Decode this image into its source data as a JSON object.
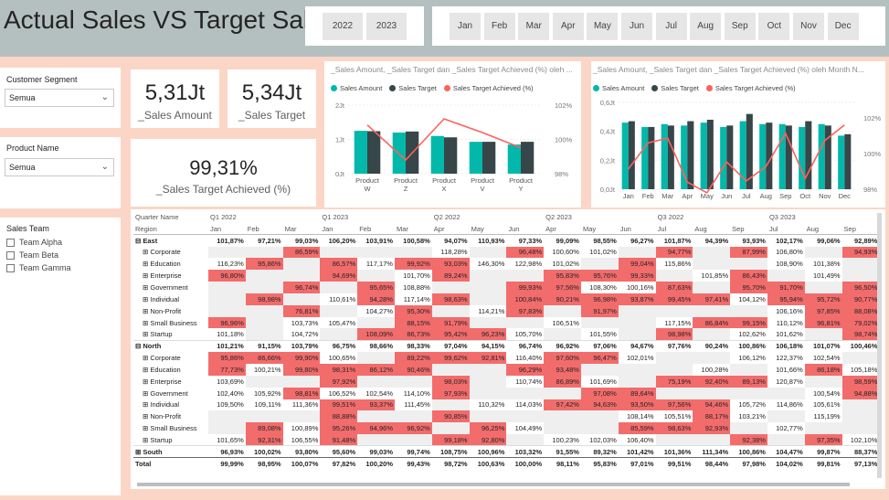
{
  "app": {
    "title": "Actual Sales VS Target Sales"
  },
  "years": [
    "2022",
    "2023"
  ],
  "months": [
    "Jan",
    "Feb",
    "Mar",
    "Apr",
    "May",
    "Jun",
    "Jul",
    "Aug",
    "Sep",
    "Oct",
    "Nov",
    "Dec"
  ],
  "slicers": {
    "segment": {
      "title": "Customer Segment",
      "value": "Semua"
    },
    "product": {
      "title": "Product Name",
      "value": "Semua"
    },
    "team": {
      "title": "Sales Team",
      "items": [
        "Team Alpha",
        "Team Beta",
        "Team Gamma"
      ]
    }
  },
  "kpis": {
    "amount": {
      "value": "5,31Jt",
      "label": "_Sales Amount"
    },
    "target": {
      "value": "5,34Jt",
      "label": "_Sales Target"
    },
    "achieved": {
      "value": "99,31%",
      "label": "_Sales Target Achieved (%)"
    }
  },
  "chart1": {
    "title": "_Sales Amount, _Sales Target dan _Sales Target Achieved (%) oleh ..."
  },
  "chart2": {
    "title": "_Sales Amount, _Sales Target dan _Sales Target Achieved (%) oleh Month N..."
  },
  "legend": [
    "Sales Amount",
    "Sales Target",
    "Sales Target Achieved (%)"
  ],
  "colors": {
    "amount": "#01b8aa",
    "target": "#374649",
    "achieved": "#fd625e",
    "highlight": "#f26c6c"
  },
  "chart_data": [
    {
      "type": "bar",
      "title": "_Sales Amount, _Sales Target dan _Sales Target Achieved (%) oleh ...",
      "categories": [
        "Product W",
        "Product Z",
        "Product X",
        "Product V",
        "Product Y"
      ],
      "series": [
        {
          "name": "Sales Amount",
          "axis": "left",
          "values": [
            1.25,
            1.2,
            1.1,
            0.93,
            0.85
          ]
        },
        {
          "name": "Sales Target",
          "axis": "left",
          "values": [
            1.24,
            1.23,
            1.06,
            0.93,
            0.93
          ]
        },
        {
          "name": "Sales Target Achieved (%)",
          "axis": "right",
          "values": [
            100.7,
            98.4,
            101.1,
            100.2,
            99.2
          ]
        }
      ],
      "yticks_left": [
        "0Jt",
        "1Jt",
        "2Jt"
      ],
      "ylim_left": [
        0,
        2
      ],
      "yticks_right": [
        "98%",
        "100%",
        "102%"
      ],
      "ylim_right": [
        97.5,
        102
      ]
    },
    {
      "type": "bar",
      "title": "_Sales Amount, _Sales Target dan _Sales Target Achieved (%) oleh Month N...",
      "categories": [
        "Jan",
        "Feb",
        "Mar",
        "Apr",
        "May",
        "Jun",
        "Jul",
        "Aug",
        "Sep",
        "Oct",
        "Nov",
        "Dec"
      ],
      "series": [
        {
          "name": "Sales Amount",
          "axis": "left",
          "values": [
            0.46,
            0.43,
            0.45,
            0.44,
            0.46,
            0.43,
            0.47,
            0.45,
            0.45,
            0.43,
            0.45,
            0.37
          ]
        },
        {
          "name": "Sales Target",
          "axis": "left",
          "values": [
            0.47,
            0.43,
            0.44,
            0.47,
            0.48,
            0.44,
            0.52,
            0.46,
            0.44,
            0.47,
            0.44,
            0.38
          ]
        },
        {
          "name": "Sales Target Achieved (%)",
          "axis": "right",
          "values": [
            98.7,
            100.9,
            101.3,
            97.6,
            96.7,
            99.3,
            97.7,
            98.9,
            101.7,
            97.9,
            101.1,
            102.4
          ]
        }
      ],
      "yticks_left": [
        "0,0Jt",
        "0,2Jt",
        "0,4Jt",
        "0,6Jt"
      ],
      "ylim_left": [
        0,
        0.6
      ],
      "yticks_right": [
        "98%",
        "100%",
        "102%"
      ],
      "ylim_right": [
        97,
        103
      ]
    }
  ],
  "matrix": {
    "header_quarter": [
      "Quarter Name",
      "Q1 2022",
      "",
      "",
      "Q1 2023",
      "",
      "",
      "Q2 2022",
      "",
      "",
      "Q2 2023",
      "",
      "",
      "Q3 2022",
      "",
      "",
      "Q3 2023",
      "",
      ""
    ],
    "header_region": [
      "Region",
      "Jan",
      "Feb",
      "Mar",
      "Jan",
      "Feb",
      "Mar",
      "Apr",
      "May",
      "Jun",
      "Apr",
      "May",
      "Jun",
      "Jul",
      "Aug",
      "Sep",
      "Jul",
      "Aug",
      "Sep"
    ],
    "rows": [
      {
        "k": "reg",
        "label": "⊟ East",
        "v": [
          "101,87%",
          "97,21%",
          "99,03%",
          "106,20%",
          "103,91%",
          "100,58%",
          "94,07%",
          "110,93%",
          "97,33%",
          "99,09%",
          "98,55%",
          "96,27%",
          "101,87%",
          "94,39%",
          "93,93%",
          "102,17%",
          "99,06%",
          "92,89%"
        ]
      },
      {
        "k": "sub",
        "label": "⊞ Corporate",
        "v": [
          "",
          "",
          "86,59%",
          "",
          "",
          "",
          "118,28%",
          "",
          "96,48%",
          "100,60%",
          "101,02%",
          "",
          "94,77%",
          "",
          "87,99%",
          "106,80%",
          "",
          "94,93%"
        ]
      },
      {
        "k": "sub",
        "label": "⊞ Education",
        "v": [
          "116,23%",
          "95,86%",
          "",
          "86,57%",
          "117,17%",
          "99,92%",
          "93,03%",
          "146,30%",
          "122,98%",
          "101,02%",
          "",
          "99,04%",
          "115,86%",
          "",
          "",
          "108,90%",
          "101,38%",
          ""
        ]
      },
      {
        "k": "sub",
        "label": "⊞ Enterprise",
        "v": [
          "96,80%",
          "",
          "",
          "94,69%",
          "",
          "101,70%",
          "89,24%",
          "",
          "",
          "95,83%",
          "95,76%",
          "99,33%",
          "",
          "101,85%",
          "86,43%",
          "",
          "101,49%",
          ""
        ]
      },
      {
        "k": "sub",
        "label": "⊞ Government",
        "v": [
          "",
          "",
          "96,74%",
          "",
          "95,65%",
          "108,88%",
          "",
          "",
          "99,93%",
          "97,56%",
          "108,30%",
          "100,16%",
          "87,63%",
          "",
          "95,70%",
          "91,70%",
          "",
          "96,50%"
        ]
      },
      {
        "k": "sub",
        "label": "⊞ Individual",
        "v": [
          "",
          "98,98%",
          "",
          "110,61%",
          "94,28%",
          "117,14%",
          "98,63%",
          "",
          "100,84%",
          "90,21%",
          "96,98%",
          "93,87%",
          "99,45%",
          "97,41%",
          "104,12%",
          "95,94%",
          "95,72%",
          "90,77%"
        ]
      },
      {
        "k": "sub",
        "label": "⊞ Non-Profit",
        "v": [
          "",
          "",
          "76,81%",
          "",
          "104,27%",
          "95,30%",
          "",
          "114,21%",
          "97,83%",
          "",
          "91,97%",
          "",
          "",
          "",
          "",
          "106,16%",
          "97,85%",
          "88,08%"
        ]
      },
      {
        "k": "sub",
        "label": "⊞ Small Business",
        "v": [
          "96,96%",
          "",
          "103,73%",
          "105,47%",
          "",
          "88,15%",
          "91,79%",
          "",
          "",
          "106,51%",
          "",
          "",
          "117,15%",
          "86,84%",
          "99,15%",
          "110,12%",
          "96,81%",
          "79,02%"
        ]
      },
      {
        "k": "sub",
        "label": "⊞ Startup",
        "v": [
          "101,18%",
          "",
          "104,72%",
          "",
          "108,09%",
          "86,73%",
          "95,42%",
          "96,23%",
          "105,70%",
          "",
          "101,55%",
          "",
          "98,98%",
          "",
          "102,62%",
          "101,62%",
          "",
          "98,74%"
        ]
      },
      {
        "k": "reg",
        "label": "⊟ North",
        "v": [
          "101,21%",
          "91,15%",
          "103,79%",
          "96,75%",
          "98,66%",
          "98,33%",
          "97,04%",
          "94,15%",
          "96,74%",
          "96,92%",
          "97,06%",
          "94,67%",
          "97,76%",
          "90,24%",
          "100,86%",
          "106,18%",
          "101,07%",
          "100,46%"
        ]
      },
      {
        "k": "sub",
        "label": "⊞ Corporate",
        "v": [
          "95,86%",
          "86,66%",
          "99,90%",
          "100,65%",
          "",
          "89,22%",
          "99,62%",
          "92,81%",
          "116,40%",
          "97,60%",
          "96,47%",
          "102,01%",
          "",
          "",
          "106,12%",
          "122,37%",
          "102,54%",
          ""
        ]
      },
      {
        "k": "sub",
        "label": "⊞ Education",
        "v": [
          "77,73%",
          "100,21%",
          "99,80%",
          "98,31%",
          "86,12%",
          "90,46%",
          "",
          "",
          "96,29%",
          "93,48%",
          "",
          "",
          "",
          "100,28%",
          "",
          "101,66%",
          "86,18%",
          "105,18%"
        ]
      },
      {
        "k": "sub",
        "label": "⊞ Enterprise",
        "v": [
          "103,69%",
          "",
          "",
          "97,92%",
          "",
          "",
          "98,03%",
          "",
          "110,74%",
          "86,89%",
          "101,69%",
          "",
          "75,19%",
          "92,40%",
          "89,13%",
          "120,87%",
          "",
          "98,59%"
        ]
      },
      {
        "k": "sub",
        "label": "⊞ Government",
        "v": [
          "102,40%",
          "105,92%",
          "98,81%",
          "106,52%",
          "102,54%",
          "114,10%",
          "97,93%",
          "",
          "",
          "",
          "97,08%",
          "89,64%",
          "",
          "",
          "",
          "",
          "100,54%",
          "94,88%"
        ]
      },
      {
        "k": "sub",
        "label": "⊞ Individual",
        "v": [
          "109,50%",
          "109,11%",
          "111,36%",
          "99,51%",
          "93,37%",
          "111,45%",
          "",
          "110,32%",
          "114,03%",
          "97,42%",
          "94,63%",
          "93,50%",
          "97,56%",
          "94,46%",
          "105,72%",
          "114,86%",
          "105,61%",
          ""
        ]
      },
      {
        "k": "sub",
        "label": "⊞ Non-Profit",
        "v": [
          "",
          "",
          "",
          "88,88%",
          "",
          "",
          "90,85%",
          "",
          "",
          "",
          "",
          "108,14%",
          "105,51%",
          "88,17%",
          "103,21%",
          "",
          "115,19%",
          ""
        ]
      },
      {
        "k": "sub",
        "label": "⊞ Small Business",
        "v": [
          "",
          "89,08%",
          "100,89%",
          "95,26%",
          "94,96%",
          "96,92%",
          "",
          "96,25%",
          "104,49%",
          "",
          "",
          "85,59%",
          "98,63%",
          "92,93%",
          "",
          "102,77%",
          "",
          ""
        ]
      },
      {
        "k": "sub",
        "label": "⊞ Startup",
        "v": [
          "101,65%",
          "92,31%",
          "106,55%",
          "91,48%",
          "",
          "",
          "99,18%",
          "92,80%",
          "",
          "100,23%",
          "102,03%",
          "106,40%",
          "",
          "",
          "92,38%",
          "",
          "97,35%",
          "102,10%"
        ]
      },
      {
        "k": "reg",
        "label": "⊞ South",
        "v": [
          "96,93%",
          "100,02%",
          "93,80%",
          "95,60%",
          "99,03%",
          "99,74%",
          "108,75%",
          "100,96%",
          "103,32%",
          "91,55%",
          "89,32%",
          "101,42%",
          "101,36%",
          "111,34%",
          "100,86%",
          "104,47%",
          "99,87%",
          "88,37%"
        ]
      },
      {
        "k": "tot",
        "label": "Total",
        "v": [
          "99,99%",
          "98,95%",
          "100,07%",
          "97,82%",
          "100,20%",
          "99,43%",
          "98,72%",
          "100,63%",
          "100,00%",
          "98,11%",
          "95,83%",
          "97,01%",
          "99,51%",
          "98,44%",
          "97,98%",
          "104,02%",
          "99,81%",
          "97,13%"
        ]
      }
    ],
    "red_cells": [
      [
        1,
        2
      ],
      [
        1,
        8
      ],
      [
        1,
        12
      ],
      [
        1,
        14
      ],
      [
        1,
        17
      ],
      [
        2,
        1
      ],
      [
        2,
        3
      ],
      [
        2,
        5
      ],
      [
        2,
        6
      ],
      [
        2,
        11
      ],
      [
        3,
        0
      ],
      [
        3,
        3
      ],
      [
        3,
        6
      ],
      [
        3,
        9
      ],
      [
        3,
        10
      ],
      [
        3,
        11
      ],
      [
        3,
        14
      ],
      [
        4,
        2
      ],
      [
        4,
        4
      ],
      [
        4,
        8
      ],
      [
        4,
        9
      ],
      [
        4,
        12
      ],
      [
        4,
        14
      ],
      [
        4,
        15
      ],
      [
        4,
        17
      ],
      [
        5,
        1
      ],
      [
        5,
        4
      ],
      [
        5,
        6
      ],
      [
        5,
        8
      ],
      [
        5,
        9
      ],
      [
        5,
        10
      ],
      [
        5,
        11
      ],
      [
        5,
        12
      ],
      [
        5,
        13
      ],
      [
        5,
        15
      ],
      [
        5,
        16
      ],
      [
        5,
        17
      ],
      [
        6,
        2
      ],
      [
        6,
        5
      ],
      [
        6,
        8
      ],
      [
        6,
        10
      ],
      [
        6,
        16
      ],
      [
        6,
        17
      ],
      [
        7,
        0
      ],
      [
        7,
        5
      ],
      [
        7,
        6
      ],
      [
        7,
        13
      ],
      [
        7,
        14
      ],
      [
        7,
        16
      ],
      [
        7,
        17
      ],
      [
        8,
        4
      ],
      [
        8,
        5
      ],
      [
        8,
        6
      ],
      [
        8,
        7
      ],
      [
        8,
        12
      ],
      [
        8,
        17
      ],
      [
        10,
        0
      ],
      [
        10,
        1
      ],
      [
        10,
        2
      ],
      [
        10,
        5
      ],
      [
        10,
        6
      ],
      [
        10,
        7
      ],
      [
        10,
        9
      ],
      [
        10,
        10
      ],
      [
        11,
        0
      ],
      [
        11,
        2
      ],
      [
        11,
        3
      ],
      [
        11,
        4
      ],
      [
        11,
        5
      ],
      [
        11,
        8
      ],
      [
        11,
        9
      ],
      [
        11,
        16
      ],
      [
        12,
        3
      ],
      [
        12,
        6
      ],
      [
        12,
        9
      ],
      [
        12,
        12
      ],
      [
        12,
        13
      ],
      [
        12,
        14
      ],
      [
        12,
        17
      ],
      [
        13,
        2
      ],
      [
        13,
        6
      ],
      [
        13,
        10
      ],
      [
        13,
        11
      ],
      [
        13,
        17
      ],
      [
        14,
        3
      ],
      [
        14,
        4
      ],
      [
        14,
        9
      ],
      [
        14,
        10
      ],
      [
        14,
        11
      ],
      [
        14,
        12
      ],
      [
        14,
        13
      ],
      [
        15,
        3
      ],
      [
        15,
        6
      ],
      [
        15,
        13
      ],
      [
        16,
        1
      ],
      [
        16,
        3
      ],
      [
        16,
        4
      ],
      [
        16,
        5
      ],
      [
        16,
        7
      ],
      [
        16,
        11
      ],
      [
        16,
        12
      ],
      [
        16,
        13
      ],
      [
        17,
        1
      ],
      [
        17,
        3
      ],
      [
        17,
        6
      ],
      [
        17,
        7
      ],
      [
        17,
        14
      ],
      [
        17,
        16
      ]
    ]
  }
}
